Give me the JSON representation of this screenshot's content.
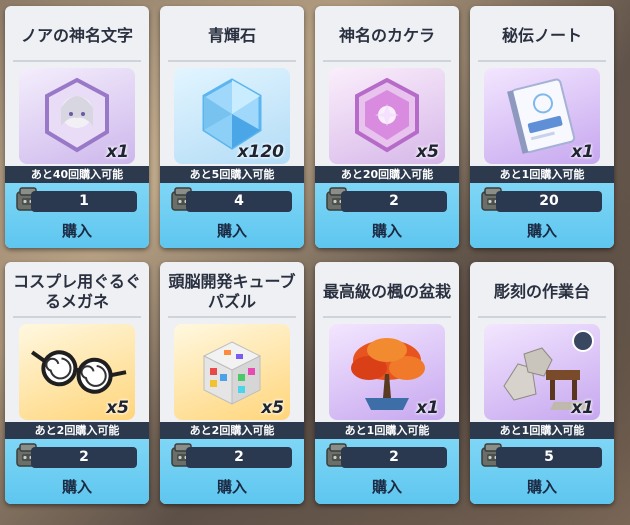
{
  "colors": {
    "card_bg": "#eef0f3",
    "buy_bg": "#6fd0f3",
    "price_bar": "#2a3850",
    "remain_bar": "#2d3a4e"
  },
  "items": [
    {
      "name": "ノアの神名文字",
      "qty": "x1",
      "remain": "あと40回購入可能",
      "price": "1",
      "buy": "購入",
      "icon": "noa-portrait-hexagon-icon"
    },
    {
      "name": "青輝石",
      "qty": "x120",
      "remain": "あと5回購入可能",
      "price": "4",
      "buy": "購入",
      "icon": "blue-crystal-icon"
    },
    {
      "name": "神名のカケラ",
      "qty": "x5",
      "remain": "あと20回購入可能",
      "price": "2",
      "buy": "購入",
      "icon": "pink-fragment-icon"
    },
    {
      "name": "秘伝ノート",
      "qty": "x1",
      "remain": "あと1回購入可能",
      "price": "20",
      "buy": "購入",
      "icon": "secret-notebook-icon"
    },
    {
      "name": "コスプレ用ぐるぐるメガネ",
      "qty": "x5",
      "remain": "あと2回購入可能",
      "price": "2",
      "buy": "購入",
      "icon": "swirl-glasses-icon"
    },
    {
      "name": "頭脳開発キューブパズル",
      "qty": "x5",
      "remain": "あと2回購入可能",
      "price": "2",
      "buy": "購入",
      "icon": "cube-puzzle-icon"
    },
    {
      "name": "最高級の楓の盆栽",
      "qty": "x1",
      "remain": "あと1回購入可能",
      "price": "2",
      "buy": "購入",
      "icon": "maple-bonsai-icon"
    },
    {
      "name": "彫刻の作業台",
      "qty": "x1",
      "remain": "あと1回購入可能",
      "price": "5",
      "buy": "購入",
      "icon": "sculpting-workbench-icon"
    }
  ]
}
